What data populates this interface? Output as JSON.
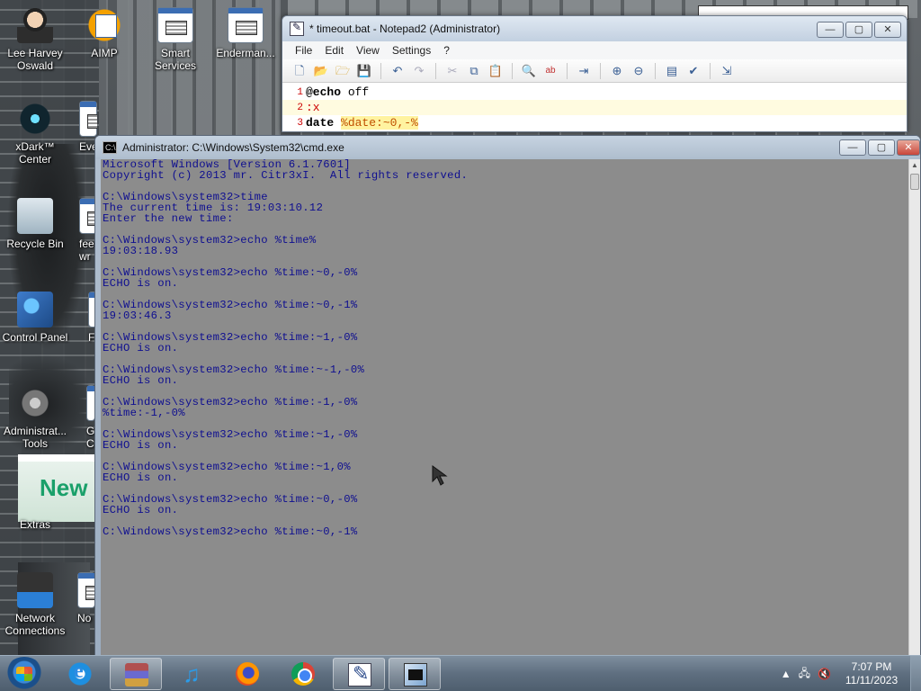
{
  "desktop": {
    "icons": [
      {
        "label": "Lee Harvey\nOswald",
        "name": "desktop-icon-lee-harvey-oswald",
        "icon": "person-icon"
      },
      {
        "label": "AIMP",
        "name": "desktop-icon-aimp",
        "icon": "aimp-icon"
      },
      {
        "label": "Smart\nServices",
        "name": "desktop-icon-smart-services",
        "icon": "gear-icon"
      },
      {
        "label": "Enderman...",
        "name": "desktop-icon-enderman",
        "icon": "batch-file-icon"
      },
      {
        "label": "xDark™\nCenter",
        "name": "desktop-icon-xdark-center",
        "icon": "xdark-icon"
      },
      {
        "label": "Eve",
        "name": "desktop-icon-eve",
        "icon": "batch-file-icon"
      },
      {
        "label": "Recycle Bin",
        "name": "desktop-icon-recycle-bin",
        "icon": "recycle-bin-icon"
      },
      {
        "label": "fee\nwr",
        "name": "desktop-icon-fee",
        "icon": "batch-file-icon"
      },
      {
        "label": "Control Panel",
        "name": "desktop-icon-control-panel",
        "icon": "control-panel-icon"
      },
      {
        "label": "F",
        "name": "desktop-icon-f",
        "icon": "batch-file-icon"
      },
      {
        "label": "Administrat...\nTools",
        "name": "desktop-icon-admin-tools",
        "icon": "admin-tools-icon"
      },
      {
        "label": "G\nC",
        "name": "desktop-icon-g",
        "icon": "batch-file-icon"
      },
      {
        "label": "Extras",
        "name": "desktop-icon-extras",
        "icon": "folder-icon"
      },
      {
        "label": "Network\nConnections",
        "name": "desktop-icon-network-connections",
        "icon": "network-icon"
      },
      {
        "label": "No",
        "name": "desktop-icon-no",
        "icon": "batch-file-icon"
      }
    ],
    "wallpaper_text": "New"
  },
  "notepad": {
    "title": "* timeout.bat - Notepad2 (Administrator)",
    "menu": [
      "File",
      "Edit",
      "View",
      "Settings",
      "?"
    ],
    "lines": [
      {
        "num": "1",
        "kw": "@echo",
        "rest": " off"
      },
      {
        "num": "2",
        "label": ":x"
      },
      {
        "num": "3",
        "kw": "date",
        "var": "%date:~0,-%"
      }
    ],
    "buttons": {
      "minimize": "—",
      "maximize": "▢",
      "close": "✕"
    }
  },
  "cmd": {
    "title": "Administrator: C:\\Windows\\System32\\cmd.exe",
    "lines": [
      "Microsoft Windows [Version 6.1.7601]",
      "Copyright (c) 2013 mr. Citr3xI.  All rights reserved.",
      "",
      "C:\\Windows\\system32>time",
      "The current time is: 19:03:10.12",
      "Enter the new time:",
      "",
      "C:\\Windows\\system32>echo %time%",
      "19:03:18.93",
      "",
      "C:\\Windows\\system32>echo %time:~0,-0%",
      "ECHO is on.",
      "",
      "C:\\Windows\\system32>echo %time:~0,-1%",
      "19:03:46.3",
      "",
      "C:\\Windows\\system32>echo %time:~1,-0%",
      "ECHO is on.",
      "",
      "C:\\Windows\\system32>echo %time:~-1,-0%",
      "ECHO is on.",
      "",
      "C:\\Windows\\system32>echo %time:-1,-0%",
      "%time:-1,-0%",
      "",
      "C:\\Windows\\system32>echo %time:~1,-0%",
      "ECHO is on.",
      "",
      "C:\\Windows\\system32>echo %time:~1,0%",
      "ECHO is on.",
      "",
      "C:\\Windows\\system32>echo %time:~0,-0%",
      "ECHO is on.",
      "",
      "C:\\Windows\\system32>echo %time:~0,-1%"
    ],
    "buttons": {
      "minimize": "—",
      "maximize": "▢",
      "close": "✕"
    }
  },
  "taskbar": {
    "apps": [
      {
        "name": "taskbar-internet-explorer",
        "icon": "internet-explorer-icon",
        "active": false
      },
      {
        "name": "taskbar-winrar",
        "icon": "winrar-icon",
        "active": true
      },
      {
        "name": "taskbar-music",
        "icon": "music-note-icon",
        "active": false
      },
      {
        "name": "taskbar-firefox",
        "icon": "firefox-icon",
        "active": false
      },
      {
        "name": "taskbar-chrome",
        "icon": "chrome-icon",
        "active": false
      },
      {
        "name": "taskbar-notepad2",
        "icon": "notepad2-icon",
        "active": true
      },
      {
        "name": "taskbar-cmd",
        "icon": "cmd-icon",
        "active": true
      }
    ],
    "clock": {
      "time": "7:07 PM",
      "date": "11/11/2023"
    }
  }
}
